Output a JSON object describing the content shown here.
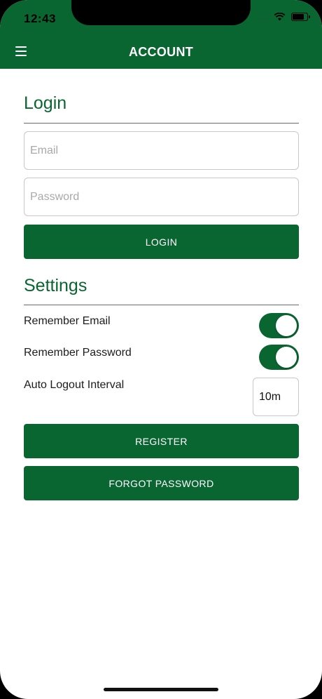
{
  "status_bar": {
    "time": "12:43",
    "signal": "....",
    "wifi_icon": "wifi-icon",
    "battery_icon": "battery-icon"
  },
  "header": {
    "title": "ACCOUNT",
    "menu_icon": "hamburger-menu-icon"
  },
  "login": {
    "title": "Login",
    "email_placeholder": "Email",
    "email_value": "",
    "password_placeholder": "Password",
    "password_value": "",
    "login_button": "LOGIN"
  },
  "settings": {
    "title": "Settings",
    "items": [
      {
        "label": "Remember Email",
        "enabled": true
      },
      {
        "label": "Remember Password",
        "enabled": true
      }
    ],
    "auto_logout_label": "Auto Logout Interval",
    "auto_logout_value": "10m"
  },
  "actions": {
    "register_button": "REGISTER",
    "forgot_password_button": "FORGOT PASSWORD"
  },
  "colors": {
    "primary": "#0a6631",
    "background": "#ffffff"
  }
}
